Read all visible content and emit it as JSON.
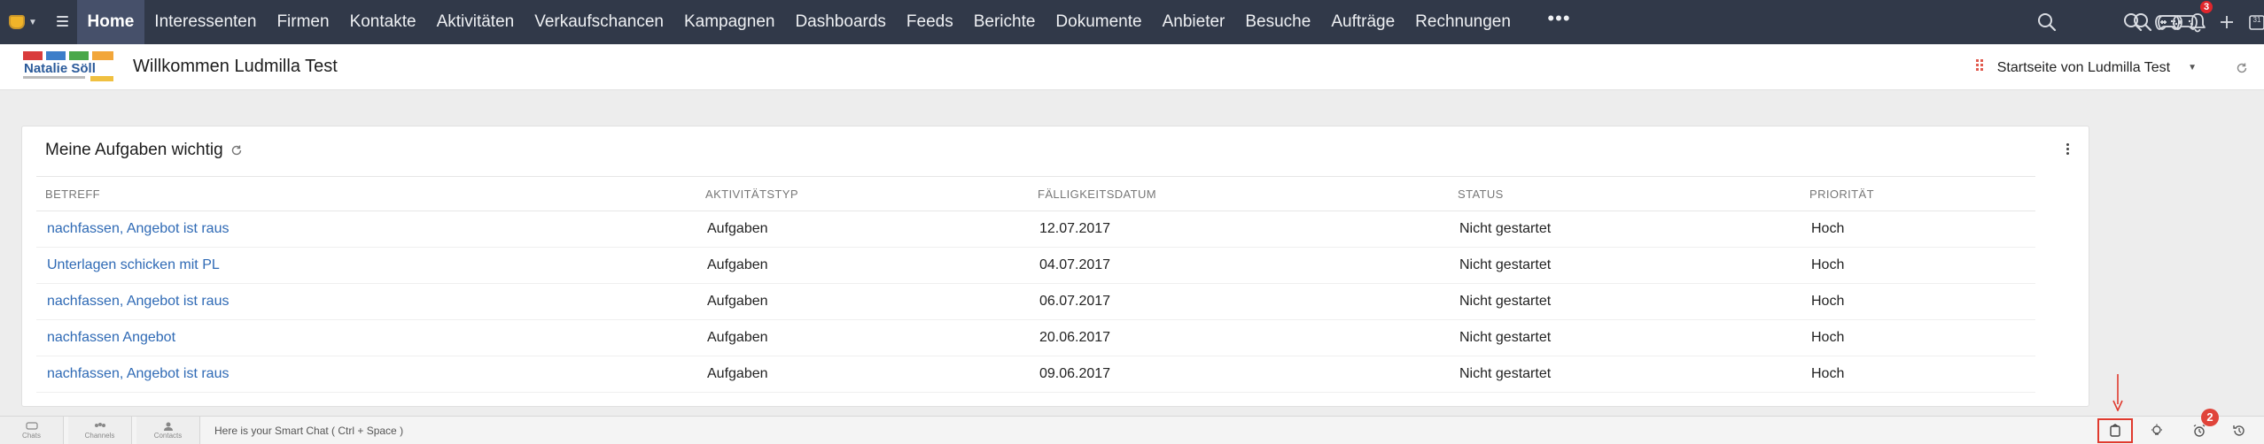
{
  "nav": {
    "tabs": [
      {
        "label": "Home",
        "active": true
      },
      {
        "label": "Interessenten"
      },
      {
        "label": "Firmen"
      },
      {
        "label": "Kontakte"
      },
      {
        "label": "Aktivitäten"
      },
      {
        "label": "Verkaufschancen"
      },
      {
        "label": "Kampagnen"
      },
      {
        "label": "Dashboards"
      },
      {
        "label": "Feeds"
      },
      {
        "label": "Berichte"
      },
      {
        "label": "Dokumente"
      },
      {
        "label": "Anbieter"
      },
      {
        "label": "Besuche"
      },
      {
        "label": "Aufträge"
      },
      {
        "label": "Rechnungen"
      }
    ],
    "more": "•••",
    "notification_count": "3",
    "calendar_day": "31"
  },
  "header": {
    "title": "Willkommen Ludmilla Test",
    "home_switch": "Startseite von Ludmilla Test",
    "logo_text": "Natalie Söll"
  },
  "widget": {
    "title": "Meine Aufgaben wichtig",
    "columns": [
      "BETREFF",
      "AKTIVITÄTSTYP",
      "FÄLLIGKEITSDATUM",
      "STATUS",
      "PRIORITÄT"
    ],
    "rows": [
      {
        "subject": "nachfassen, Angebot ist raus",
        "type": "Aufgaben",
        "due": "12.07.2017",
        "status": "Nicht gestartet",
        "priority": "Hoch"
      },
      {
        "subject": "Unterlagen schicken mit PL",
        "type": "Aufgaben",
        "due": "04.07.2017",
        "status": "Nicht gestartet",
        "priority": "Hoch"
      },
      {
        "subject": "nachfassen, Angebot ist raus",
        "type": "Aufgaben",
        "due": "06.07.2017",
        "status": "Nicht gestartet",
        "priority": "Hoch"
      },
      {
        "subject": "nachfassen Angebot",
        "type": "Aufgaben",
        "due": "20.06.2017",
        "status": "Nicht gestartet",
        "priority": "Hoch"
      },
      {
        "subject": "nachfassen, Angebot ist raus",
        "type": "Aufgaben",
        "due": "09.06.2017",
        "status": "Nicht gestartet",
        "priority": "Hoch"
      }
    ]
  },
  "footer": {
    "tabs": [
      "Chats",
      "Channels",
      "Contacts"
    ],
    "smart_chat_placeholder": "Here is your Smart Chat ( Ctrl + Space )",
    "reminder_badge": "2"
  },
  "colors": {
    "nav_bg": "#313949",
    "nav_active": "#46506a",
    "link": "#2f6ab5",
    "badge": "#e0262c",
    "highlight": "#e03a2e"
  }
}
